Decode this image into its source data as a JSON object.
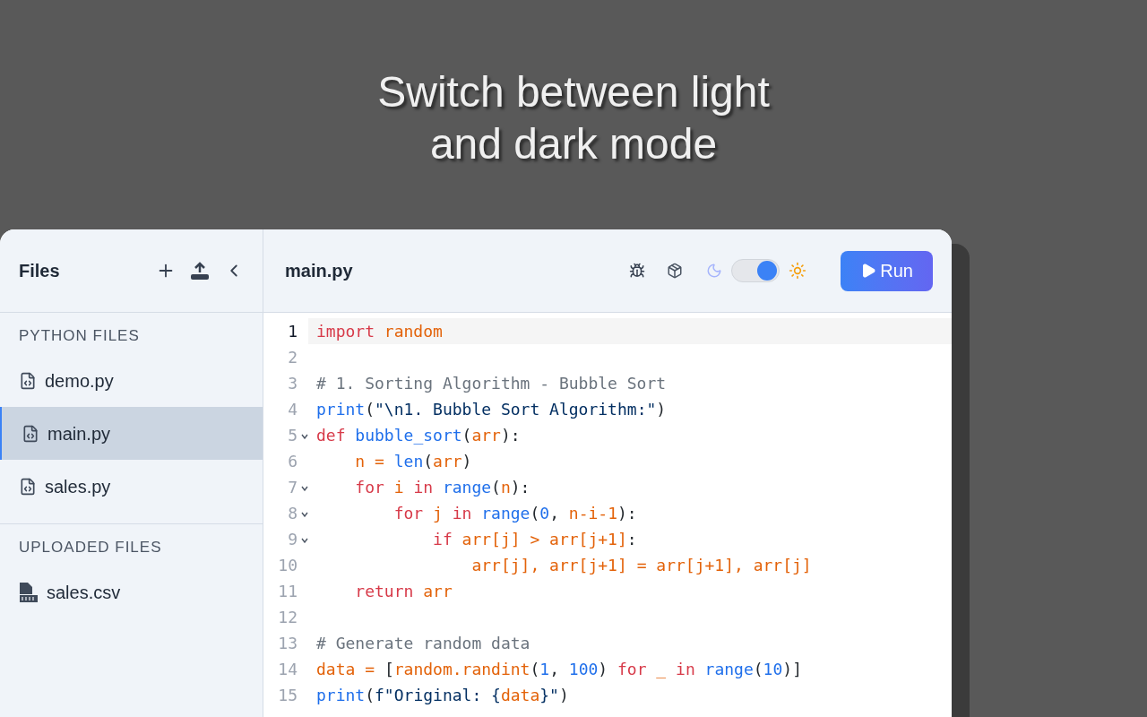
{
  "headline": [
    "Switch between light",
    "and dark mode"
  ],
  "sidebar": {
    "title": "Files",
    "sections": [
      {
        "heading": "PYTHON FILES",
        "items": [
          {
            "name": "demo.py",
            "kind": "code",
            "selected": false
          },
          {
            "name": "main.py",
            "kind": "code",
            "selected": true
          },
          {
            "name": "sales.py",
            "kind": "code",
            "selected": false
          }
        ]
      },
      {
        "heading": "UPLOADED FILES",
        "items": [
          {
            "name": "sales.csv",
            "kind": "csv",
            "selected": false
          }
        ]
      }
    ]
  },
  "editor": {
    "filename": "main.py",
    "theme_toggle": {
      "on": true
    },
    "run_button": "Run",
    "lines": [
      {
        "number": "1",
        "active": true,
        "fold": false,
        "tokens": [
          {
            "text": "import ",
            "kind": "keyword"
          },
          {
            "text": "random",
            "kind": "variable"
          }
        ]
      },
      {
        "number": "2",
        "active": false,
        "fold": false
      },
      {
        "number": "3",
        "active": false,
        "fold": false,
        "tokens": [
          {
            "text": "# 1. Sorting Algorithm - Bubble Sort",
            "kind": "comment"
          }
        ]
      },
      {
        "number": "4",
        "active": false,
        "fold": false,
        "tokens": [
          {
            "text": "print",
            "kind": "function"
          },
          {
            "text": "(",
            "kind": "punctuation"
          },
          {
            "text": "\"\\n1. Bubble Sort Algorithm:\"",
            "kind": "string"
          },
          {
            "text": ")",
            "kind": "punctuation"
          }
        ]
      },
      {
        "number": "5",
        "active": false,
        "fold": true,
        "tokens": [
          {
            "text": "def ",
            "kind": "keyword"
          },
          {
            "text": "bubble_sort",
            "kind": "function"
          },
          {
            "text": "(",
            "kind": "punctuation"
          },
          {
            "text": "arr",
            "kind": "variable"
          },
          {
            "text": "):",
            "kind": "punctuation"
          }
        ]
      },
      {
        "number": "6",
        "active": false,
        "fold": false,
        "tokens": [
          {
            "text": "    n",
            "kind": "variable"
          },
          {
            "text": " = ",
            "kind": "operator"
          },
          {
            "text": "len",
            "kind": "function"
          },
          {
            "text": "(",
            "kind": "punctuation"
          },
          {
            "text": "arr",
            "kind": "variable"
          },
          {
            "text": ")",
            "kind": "punctuation"
          }
        ]
      },
      {
        "number": "7",
        "active": false,
        "fold": true,
        "tokens": [
          {
            "text": "    for",
            "kind": "keyword"
          },
          {
            "text": " i ",
            "kind": "variable"
          },
          {
            "text": "in",
            "kind": "keyword"
          },
          {
            "text": " range",
            "kind": "function"
          },
          {
            "text": "(",
            "kind": "punctuation"
          },
          {
            "text": "n",
            "kind": "variable"
          },
          {
            "text": "):",
            "kind": "punctuation"
          }
        ]
      },
      {
        "number": "8",
        "active": false,
        "fold": true,
        "tokens": [
          {
            "text": "        for",
            "kind": "keyword"
          },
          {
            "text": " j ",
            "kind": "variable"
          },
          {
            "text": "in",
            "kind": "keyword"
          },
          {
            "text": " range",
            "kind": "function"
          },
          {
            "text": "(",
            "kind": "punctuation"
          },
          {
            "text": "0",
            "kind": "number"
          },
          {
            "text": ", ",
            "kind": "punctuation"
          },
          {
            "text": "n-i-1",
            "kind": "variable"
          },
          {
            "text": "):",
            "kind": "punctuation"
          }
        ]
      },
      {
        "number": "9",
        "active": false,
        "fold": true,
        "tokens": [
          {
            "text": "            if",
            "kind": "keyword"
          },
          {
            "text": " arr[j] ",
            "kind": "variable"
          },
          {
            "text": ">",
            "kind": "operator"
          },
          {
            "text": " arr[j+1]",
            "kind": "variable"
          },
          {
            "text": ":",
            "kind": "punctuation"
          }
        ]
      },
      {
        "number": "10",
        "active": false,
        "fold": false,
        "tokens": [
          {
            "text": "                arr[j], arr[j+1] ",
            "kind": "variable"
          },
          {
            "text": "=",
            "kind": "operator"
          },
          {
            "text": " arr[j+1], arr[j]",
            "kind": "variable"
          }
        ]
      },
      {
        "number": "11",
        "active": false,
        "fold": false,
        "tokens": [
          {
            "text": "    return",
            "kind": "keyword"
          },
          {
            "text": " arr",
            "kind": "variable"
          }
        ]
      },
      {
        "number": "12",
        "active": false,
        "fold": false
      },
      {
        "number": "13",
        "active": false,
        "fold": false,
        "tokens": [
          {
            "text": "# Generate random data",
            "kind": "comment"
          }
        ]
      },
      {
        "number": "14",
        "active": false,
        "fold": false,
        "tokens": [
          {
            "text": "data",
            "kind": "variable"
          },
          {
            "text": " = ",
            "kind": "operator"
          },
          {
            "text": "[",
            "kind": "punctuation"
          },
          {
            "text": "random.randint",
            "kind": "variable"
          },
          {
            "text": "(",
            "kind": "punctuation"
          },
          {
            "text": "1",
            "kind": "number"
          },
          {
            "text": ", ",
            "kind": "punctuation"
          },
          {
            "text": "100",
            "kind": "number"
          },
          {
            "text": ") ",
            "kind": "punctuation"
          },
          {
            "text": "for",
            "kind": "keyword"
          },
          {
            "text": " _ ",
            "kind": "variable"
          },
          {
            "text": "in",
            "kind": "keyword"
          },
          {
            "text": " range",
            "kind": "function"
          },
          {
            "text": "(",
            "kind": "punctuation"
          },
          {
            "text": "10",
            "kind": "number"
          },
          {
            "text": ")]",
            "kind": "punctuation"
          }
        ]
      },
      {
        "number": "15",
        "active": false,
        "fold": false,
        "tokens": [
          {
            "text": "print",
            "kind": "function"
          },
          {
            "text": "(",
            "kind": "punctuation"
          },
          {
            "text": "f\"Original: {",
            "kind": "string"
          },
          {
            "text": "data",
            "kind": "variable"
          },
          {
            "text": "}\"",
            "kind": "string"
          },
          {
            "text": ")",
            "kind": "punctuation"
          }
        ]
      }
    ]
  }
}
